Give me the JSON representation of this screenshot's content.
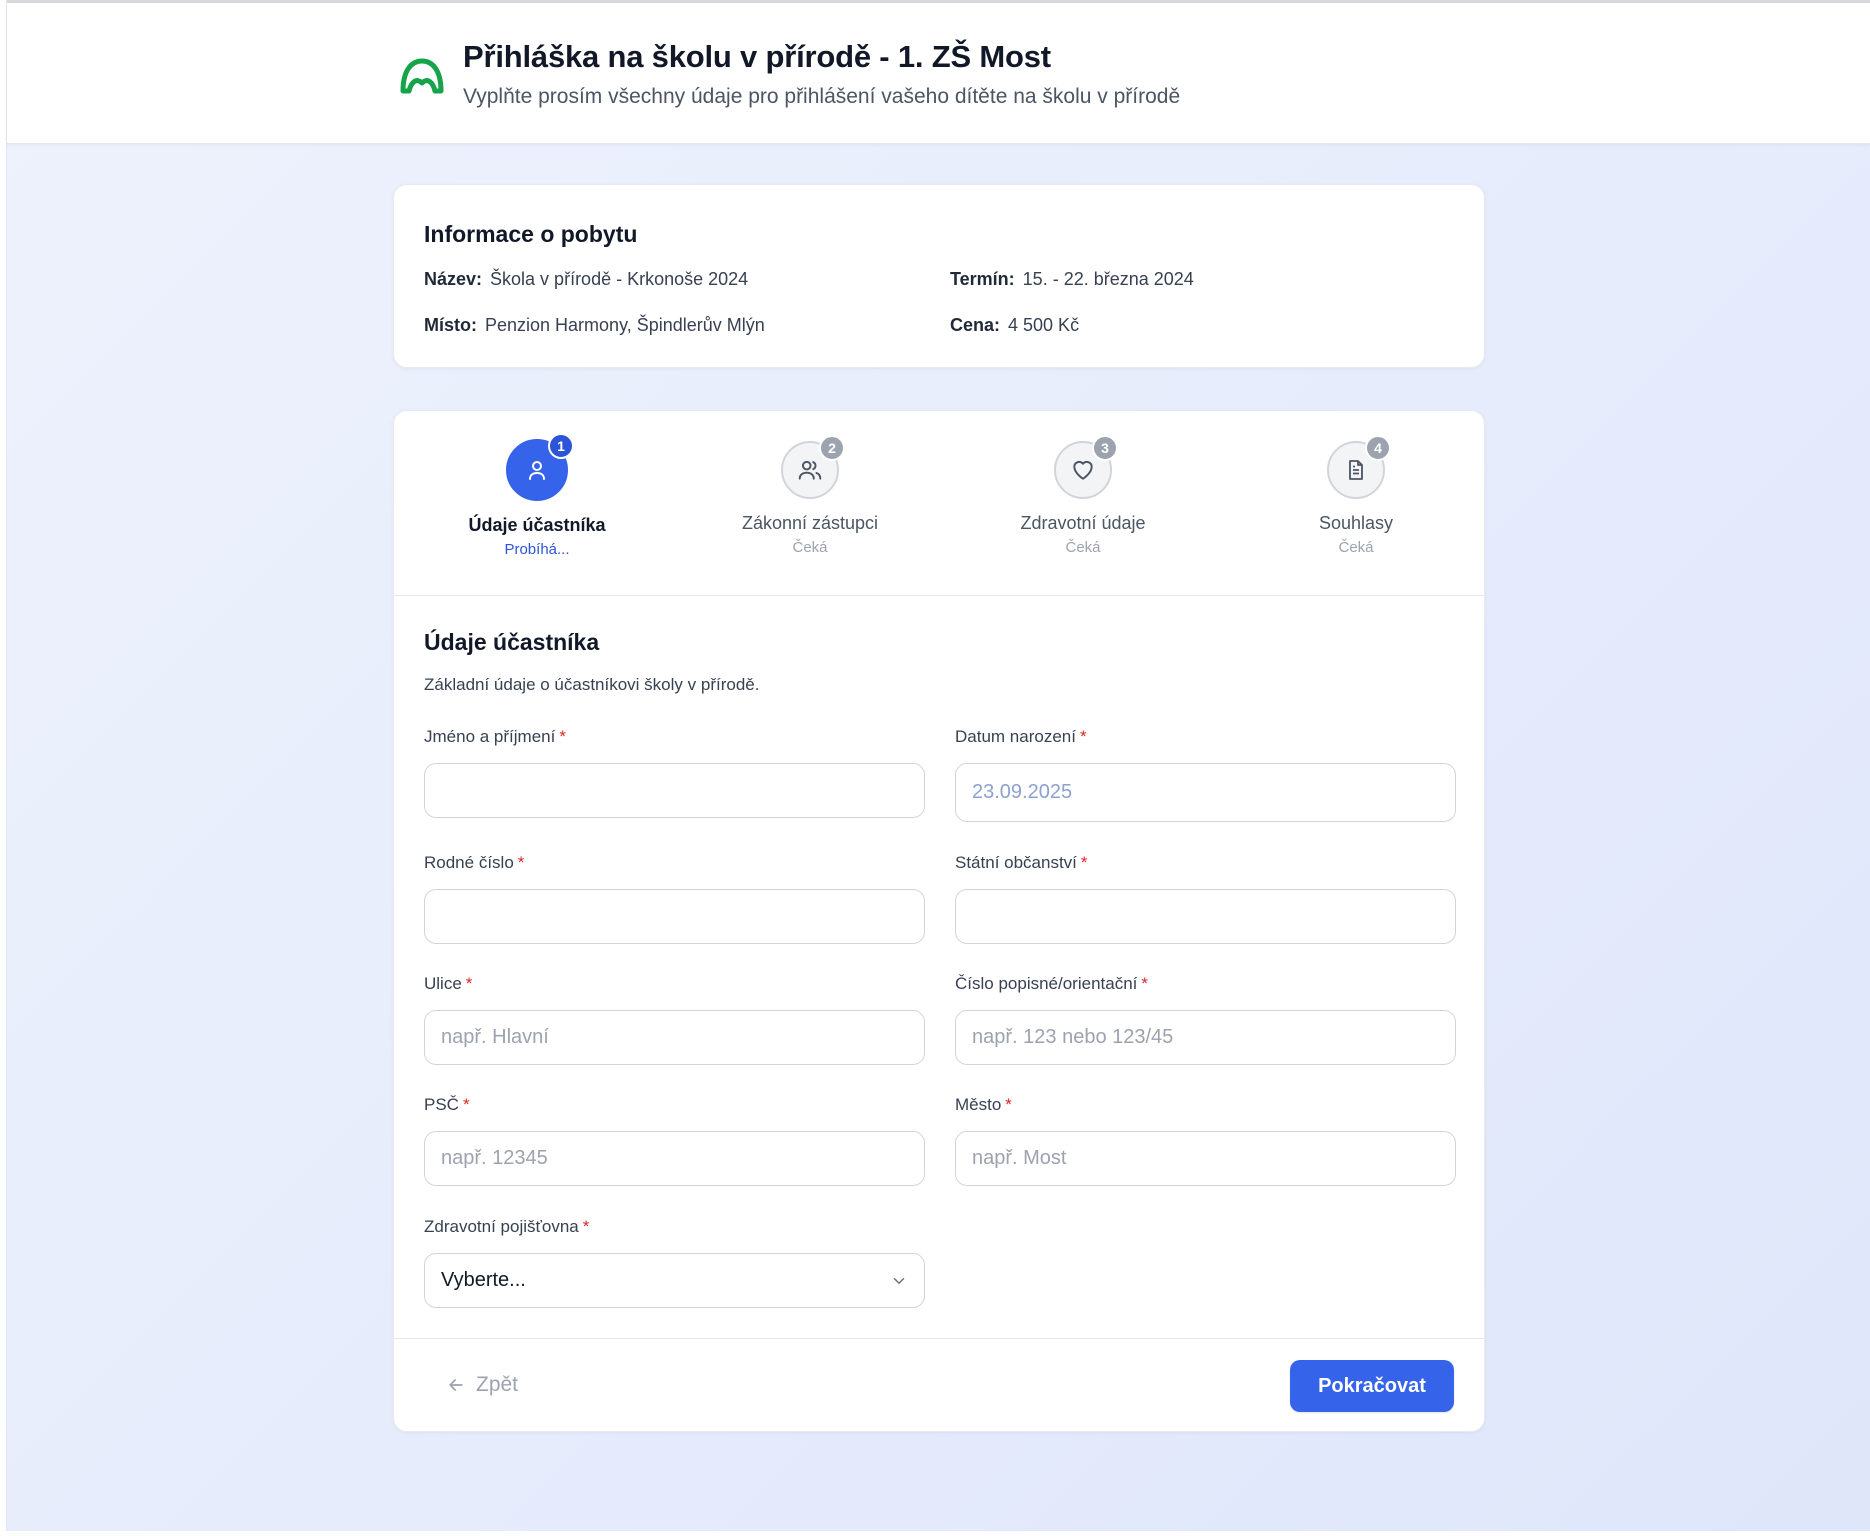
{
  "header": {
    "title": "Přihláška na školu v přírodě - 1. ZŠ Most",
    "subtitle": "Vyplňte prosím všechny údaje pro přihlášení vašeho dítěte na školu v přírodě",
    "logo_icon": "school-arch-icon",
    "logo_color": "#16a34a"
  },
  "stay_info": {
    "title": "Informace o pobytu",
    "name_key": "Název:",
    "name_value": "Škola v přírodě - Krkonoše 2024",
    "term_key": "Termín:",
    "term_value": "15. - 22. března 2024",
    "place_key": "Místo:",
    "place_value": "Penzion Harmony, Špindlerův Mlýn",
    "price_key": "Cena:",
    "price_value": "4 500 Kč"
  },
  "steps": [
    {
      "number": "1",
      "label": "Údaje účastníka",
      "status": "Probíhá...",
      "icon": "user-icon",
      "active": true
    },
    {
      "number": "2",
      "label": "Zákonní zástupci",
      "status": "Čeká",
      "icon": "users-icon",
      "active": false
    },
    {
      "number": "3",
      "label": "Zdravotní údaje",
      "status": "Čeká",
      "icon": "heart-icon",
      "active": false
    },
    {
      "number": "4",
      "label": "Souhlasy",
      "status": "Čeká",
      "icon": "document-icon",
      "active": false
    }
  ],
  "section": {
    "title": "Údaje účastníka",
    "description": "Základní údaje o účastníkovi školy v přírodě."
  },
  "fields": {
    "full_name": {
      "label": "Jméno a příjmení",
      "required": "*",
      "value": "",
      "placeholder": ""
    },
    "birth_date": {
      "label": "Datum narození",
      "required": "*",
      "value": "23.09.2025"
    },
    "birth_number": {
      "label": "Rodné číslo",
      "required": "*",
      "value": "",
      "placeholder": ""
    },
    "citizenship": {
      "label": "Státní občanství",
      "required": "*",
      "value": "",
      "placeholder": ""
    },
    "street": {
      "label": "Ulice",
      "required": "*",
      "value": "",
      "placeholder": "např. Hlavní"
    },
    "house_number": {
      "label": "Číslo popisné/orientační",
      "required": "*",
      "value": "",
      "placeholder": "např. 123 nebo 123/45"
    },
    "zip": {
      "label": "PSČ",
      "required": "*",
      "value": "",
      "placeholder": "např. 12345"
    },
    "city": {
      "label": "Město",
      "required": "*",
      "value": "",
      "placeholder": "např. Most"
    },
    "insurance": {
      "label": "Zdravotní pojišťovna",
      "required": "*",
      "selected": "Vyberte..."
    }
  },
  "nav": {
    "back_label": "Zpět",
    "next_label": "Pokračovat"
  },
  "colors": {
    "primary": "#3563e9",
    "required": "#e02424",
    "pending": "#9ca3af"
  }
}
